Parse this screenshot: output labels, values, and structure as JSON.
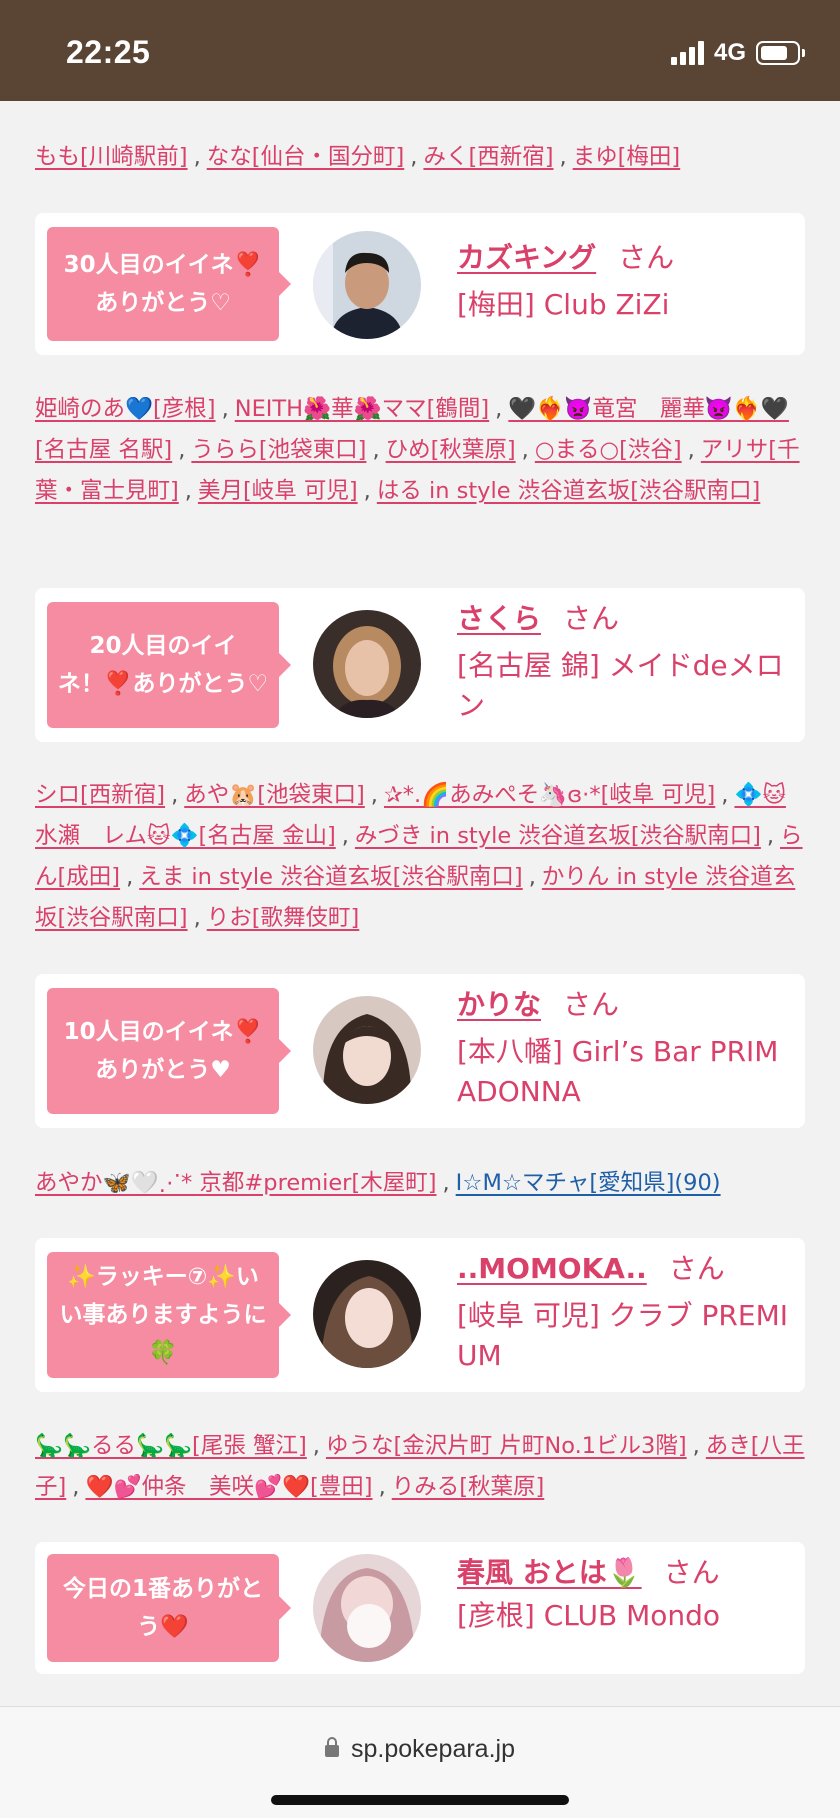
{
  "status_bar": {
    "time": "22:25",
    "network": "4G"
  },
  "browser": {
    "url": "sp.pokepara.jp"
  },
  "link_groups": [
    [
      {
        "text": "もも[川崎駅前]"
      },
      {
        "text": "なな[仙台・国分町]"
      },
      {
        "text": "みく[西新宿]"
      },
      {
        "text": "まゆ[梅田]"
      }
    ],
    [
      {
        "text": "姫崎のあ💙[彦根]"
      },
      {
        "text": "NEITH🌺華🌺ママ[鶴間]"
      },
      {
        "text": "🖤❤️‍🔥👿竜宮　麗華👿❤️‍🔥🖤[名古屋 名駅]"
      },
      {
        "text": "うらら[池袋東口]"
      },
      {
        "text": "ひめ[秋葉原]"
      },
      {
        "text": "○まる○[渋谷]"
      },
      {
        "text": "アリサ[千葉・富士見町]"
      },
      {
        "text": "美月[岐阜 可児]"
      },
      {
        "text": "はる in style 渋谷道玄坂[渋谷駅南口]"
      }
    ],
    [
      {
        "text": "シロ[西新宿]"
      },
      {
        "text": "あや🐹[池袋東口]"
      },
      {
        "text": "✰*.🌈あみぺそ🦄ɞ‧*[岐阜 可児]"
      },
      {
        "text": "💠🐱水瀬　レム🐱💠[名古屋 金山]"
      },
      {
        "text": "みづき in style 渋谷道玄坂[渋谷駅南口]"
      },
      {
        "text": "らん[成田]"
      },
      {
        "text": "えま in style 渋谷道玄坂[渋谷駅南口]"
      },
      {
        "text": "かりん in style 渋谷道玄坂[渋谷駅南口]"
      },
      {
        "text": "りお[歌舞伎町]"
      }
    ],
    [
      {
        "text": "あやか🦋🤍⋰* 京都#premier[木屋町]"
      },
      {
        "text": "I☆M☆マチャ[愛知県](90)",
        "style": "blue"
      }
    ],
    [
      {
        "text": "🦕🦕るる🦕🦕[尾張 蟹江]"
      },
      {
        "text": "ゆうな[金沢片町 片町No.1ビル3階]"
      },
      {
        "text": "あき[八王子]"
      },
      {
        "text": "❤️💕仲条　美咲💕❤️[豊田]"
      },
      {
        "text": "りみる[秋葉原]"
      }
    ]
  ],
  "separator": ",",
  "cards": [
    {
      "badge": "30人目のイイネ❣️ありがとう♡",
      "name": "カズキング",
      "honorific": "さん",
      "shop": "[梅田] Club ZiZi"
    },
    {
      "badge": "20人目のイイネ！❣️ありがとう♡",
      "name": "さくら",
      "honorific": "さん",
      "shop": "[名古屋 錦] メイドdeメロン"
    },
    {
      "badge": "10人目のイイネ❣️ありがとう♥",
      "name": "かりな",
      "honorific": "さん",
      "shop": "[本八幡] Girl’s Bar PRIMADONNA"
    },
    {
      "badge": "✨ラッキー⑦✨いい事ありますように🍀",
      "name": "..MOMOKA..",
      "honorific": "さん",
      "shop": "[岐阜 可児] クラブ PREMIUM"
    },
    {
      "badge": "今日の1番ありがとう❤️",
      "name": "春風 おとは🌷",
      "honorific": "さん",
      "shop": "[彦根] CLUB Mondo"
    }
  ],
  "colors": {
    "accent": "#d9406a",
    "badge_bg": "#f58ca2",
    "status_bar_bg": "#5a4535"
  }
}
